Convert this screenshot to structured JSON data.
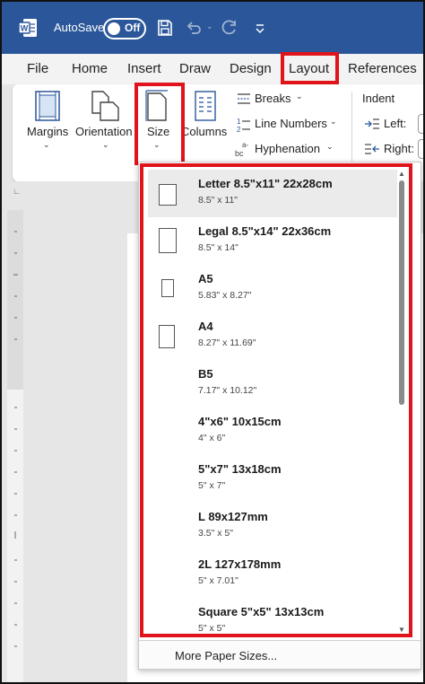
{
  "titlebar": {
    "autosave_label": "AutoSave",
    "autosave_state": "Off"
  },
  "tabs": [
    {
      "label": "File"
    },
    {
      "label": "Home"
    },
    {
      "label": "Insert"
    },
    {
      "label": "Draw"
    },
    {
      "label": "Design"
    },
    {
      "label": "Layout"
    },
    {
      "label": "References"
    }
  ],
  "ribbon": {
    "margins": "Margins",
    "orientation": "Orientation",
    "size": "Size",
    "columns": "Columns",
    "breaks": "Breaks",
    "line_numbers": "Line Numbers",
    "hyphenation": "Hyphenation",
    "indent": "Indent",
    "indent_left": "Left:",
    "indent_right": "Right:"
  },
  "size_menu": {
    "items": [
      {
        "name": "Letter 8.5\"x11\" 22x28cm",
        "dims": "8.5\" x 11\""
      },
      {
        "name": "Legal 8.5\"x14\" 22x36cm",
        "dims": "8.5\" x 14\""
      },
      {
        "name": "A5",
        "dims": "5.83\" x 8.27\""
      },
      {
        "name": "A4",
        "dims": "8.27\" x 11.69\""
      },
      {
        "name": "B5",
        "dims": "7.17\" x 10.12\""
      },
      {
        "name": "4\"x6\" 10x15cm",
        "dims": "4\" x 6\""
      },
      {
        "name": "5\"x7\" 13x18cm",
        "dims": "5\" x 7\""
      },
      {
        "name": "L 89x127mm",
        "dims": "3.5\" x 5\""
      },
      {
        "name": "2L 127x178mm",
        "dims": "5\" x 7.01\""
      },
      {
        "name": "Square 5\"x5\" 13x13cm",
        "dims": "5\" x 5\""
      }
    ],
    "more_label": "More Paper Sizes..."
  },
  "colors": {
    "titlebar": "#2b579a",
    "highlight": "#e0141b"
  },
  "icons": [
    "word-icon",
    "save-icon",
    "undo-icon",
    "redo-icon",
    "customize-qat-icon",
    "margins-icon",
    "orientation-icon",
    "size-icon",
    "columns-icon",
    "breaks-icon",
    "line-numbers-icon",
    "hyphenation-icon",
    "indent-left-icon",
    "indent-right-icon"
  ]
}
